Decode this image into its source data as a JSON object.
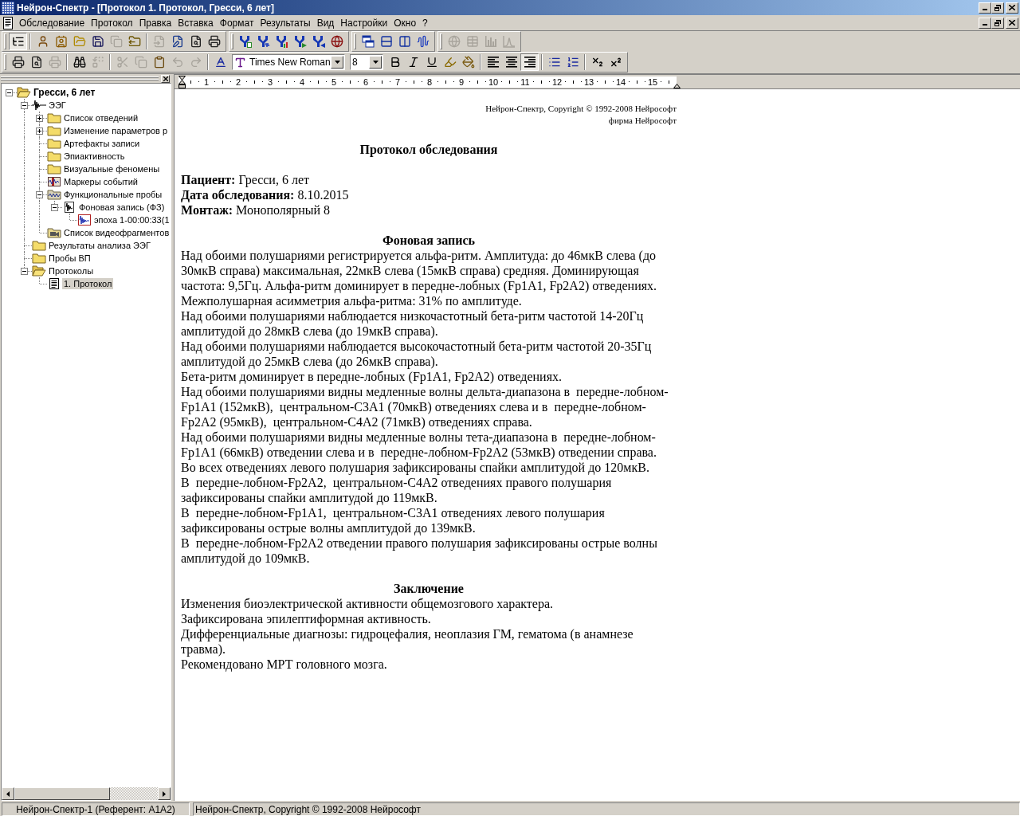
{
  "window": {
    "title": "Нейрон-Спектр - [Протокол 1. Протокол, Гресси, 6 лет]"
  },
  "menu": [
    "Обследование",
    "Протокол",
    "Правка",
    "Вставка",
    "Формат",
    "Результаты",
    "Вид",
    "Настройки",
    "Окно",
    "?"
  ],
  "toolbar_rows": [
    [
      {
        "buttons": [
          {
            "pressed": true,
            "disabled": false
          },
          {
            "pressed": false,
            "disabled": false
          },
          {
            "pressed": false,
            "disabled": false
          },
          {
            "pressed": false,
            "disabled": false
          },
          {
            "pressed": false,
            "disabled": false
          },
          {
            "pressed": false,
            "disabled": true
          },
          {
            "pressed": false,
            "disabled": false
          },
          {
            "pressed": false,
            "disabled": true
          },
          {
            "pressed": false,
            "disabled": false
          },
          {
            "pressed": false,
            "disabled": false
          },
          {
            "pressed": false,
            "disabled": false
          }
        ]
      },
      {
        "buttons": [
          {
            "pressed": false,
            "disabled": false
          },
          {
            "pressed": false,
            "disabled": false
          },
          {
            "pressed": false,
            "disabled": false
          },
          {
            "pressed": false,
            "disabled": false
          },
          {
            "pressed": false,
            "disabled": false
          },
          {
            "pressed": false,
            "disabled": false
          }
        ]
      },
      {
        "buttons": [
          {
            "pressed": false,
            "disabled": false
          },
          {
            "pressed": false,
            "disabled": false
          },
          {
            "pressed": false,
            "disabled": false
          },
          {
            "pressed": false,
            "disabled": false
          }
        ]
      },
      {
        "buttons": [
          {
            "pressed": false,
            "disabled": true
          },
          {
            "pressed": false,
            "disabled": true
          },
          {
            "pressed": false,
            "disabled": true
          },
          {
            "pressed": false,
            "disabled": true
          }
        ]
      }
    ],
    [
      {
        "buttons": [
          {
            "pressed": false,
            "disabled": false
          },
          {
            "pressed": false,
            "disabled": false
          },
          {
            "pressed": false,
            "disabled": true
          },
          {
            "pressed": false,
            "disabled": false
          },
          {
            "pressed": false,
            "disabled": true
          },
          {
            "pressed": false,
            "disabled": true
          },
          {
            "pressed": false,
            "disabled": true
          },
          {
            "pressed": false,
            "disabled": false
          },
          {
            "pressed": false,
            "disabled": true
          },
          {
            "pressed": false,
            "disabled": true
          },
          {
            "pressed": false,
            "disabled": false
          },
          {
            "pressed": false,
            "disabled": false
          },
          {
            "pressed": false,
            "disabled": false
          },
          {
            "pressed": false,
            "disabled": false
          },
          {
            "pressed": false,
            "disabled": false
          },
          {
            "pressed": false,
            "disabled": false
          },
          {
            "pressed": false,
            "disabled": false
          },
          {
            "pressed": false,
            "disabled": false
          },
          {
            "pressed": true,
            "disabled": false
          },
          {
            "pressed": false,
            "disabled": false
          },
          {
            "pressed": false,
            "disabled": false
          },
          {
            "pressed": false,
            "disabled": false
          },
          {
            "pressed": false,
            "disabled": false
          }
        ],
        "font": {
          "value": "Times New Roman"
        },
        "font_size": {
          "value": "8"
        }
      }
    ]
  ],
  "tree": [
    {
      "label": "Гресси, 6 лет",
      "kind": "folder",
      "has_children": true,
      "expanded": true,
      "selected": false,
      "children": [
        {
          "label": "ЭЭГ",
          "kind": "eeg",
          "has_children": true,
          "expanded": true,
          "selected": false,
          "children": [
            {
              "label": "Список отведений",
              "kind": "folder",
              "has_children": true,
              "expanded": false,
              "selected": false
            },
            {
              "label": "Изменение параметров р",
              "kind": "folder",
              "has_children": true,
              "expanded": false,
              "selected": false
            },
            {
              "label": "Артефакты записи",
              "kind": "folder",
              "has_children": false,
              "expanded": false,
              "selected": false
            },
            {
              "label": "Эпиактивность",
              "kind": "folder",
              "has_children": false,
              "expanded": false,
              "selected": false
            },
            {
              "label": "Визуальные феномены",
              "kind": "folder",
              "has_children": false,
              "expanded": false,
              "selected": false
            },
            {
              "label": "Маркеры событий",
              "kind": "markers",
              "has_children": false,
              "expanded": false,
              "selected": false
            },
            {
              "label": "Функциональные пробы",
              "kind": "probes",
              "has_children": true,
              "expanded": true,
              "selected": false,
              "children": [
                {
                  "label": "Фоновая запись (ФЗ)",
                  "kind": "record",
                  "has_children": true,
                  "expanded": true,
                  "selected": false,
                  "children": [
                    {
                      "label": "эпоха 1-00:00:33(1",
                      "kind": "epoch",
                      "has_children": false,
                      "expanded": false,
                      "selected": false
                    }
                  ]
                }
              ]
            },
            {
              "label": "Список видеофрагментов",
              "kind": "video",
              "has_children": false,
              "expanded": false,
              "selected": false
            }
          ]
        },
        {
          "label": "Результаты анализа ЭЭГ",
          "kind": "folder",
          "has_children": false,
          "expanded": false,
          "selected": false
        },
        {
          "label": "Пробы ВП",
          "kind": "folder",
          "has_children": false,
          "expanded": false,
          "selected": false
        },
        {
          "label": "Протоколы",
          "kind": "folder",
          "has_children": true,
          "expanded": true,
          "selected": false,
          "children": [
            {
              "label": "1. Протокол",
              "kind": "protocol",
              "has_children": false,
              "expanded": false,
              "selected": true
            }
          ]
        }
      ]
    }
  ],
  "ruler": {
    "numbers": [
      "1",
      "2",
      "3",
      "4",
      "5",
      "6",
      "7",
      "8",
      "9",
      "10",
      "11",
      "12",
      "13",
      "14",
      "15"
    ]
  },
  "document": {
    "header": [
      "Нейрон-Спектр, Copyright © 1992-2008 Нейрософт",
      "фирма Нейрософт"
    ],
    "title": "Протокол обследования",
    "fields": [
      "**Пациент:** Гресси, 6 лет",
      "**Дата обследования:** 8.10.2015",
      "**Монтаж:** Монополярный 8"
    ],
    "sections": [
      {
        "heading": "Фоновая запись",
        "paragraphs": [
          "Над обоими полушариями регистрируется альфа-ритм. Амплитуда: до 46мкВ слева (до 30мкВ справа) максимальная, 22мкВ слева (15мкВ справа) средняя. Доминирующая частота: 9,5Гц. Альфа-ритм доминирует в передне-лобных (Fp1A1, Fp2A2) отведениях.",
          "Межполушарная асимметрия альфа-ритма: 31% по амплитуде.",
          "Над обоими полушариями наблюдается низкочастотный бета-ритм частотой 14-20Гц амплитудой до 28мкВ слева (до 19мкВ справа).",
          "Над обоими полушариями наблюдается высокочастотный бета-ритм частотой 20-35Гц амплитудой до 25мкВ слева (до 26мкВ справа).",
          "Бета-ритм доминирует в передне-лобных (Fp1A1, Fp2A2) отведениях.",
          "Над обоими полушариями видны медленные волны дельта-диапазона в  передне-лобном-Fp1A1 (152мкВ),  центральном-C3A1 (70мкВ) отведениях слева и в  передне-лобном-Fp2A2 (95мкВ),  центральном-C4A2 (71мкВ) отведениях справа.",
          "Над обоими полушариями видны медленные волны тета-диапазона в  передне-лобном-Fp1A1 (66мкВ) отведении слева и в  передне-лобном-Fp2A2 (53мкВ) отведении справа.",
          "Во всех отведениях левого полушария зафиксированы спайки амплитудой до 120мкВ.",
          "В  передне-лобном-Fp2A2,  центральном-C4A2 отведениях правого полушария зафиксированы спайки амплитудой до 119мкВ.",
          "В  передне-лобном-Fp1A1,  центральном-C3A1 отведениях левого полушария зафиксированы острые волны амплитудой до 139мкВ.",
          "В  передне-лобном-Fp2A2 отведении правого полушария зафиксированы острые волны амплитудой до 109мкВ."
        ]
      },
      {
        "heading": "Заключение",
        "paragraphs": [
          "Изменения биоэлектрической активности общемозгового характера.",
          "Зафиксирована эпилептиформная активность.",
          "Дифференциальные диагнозы: гидроцефалия, неоплазия ГМ, гематома (в анамнезе травма).",
          "Рекомендовано МРТ головного мозга."
        ]
      }
    ]
  },
  "status_bar": [
    "Нейрон-Спектр-1 (Референт: A1A2)",
    "Нейрон-Спектр, Copyright © 1992-2008 Нейрософт"
  ]
}
